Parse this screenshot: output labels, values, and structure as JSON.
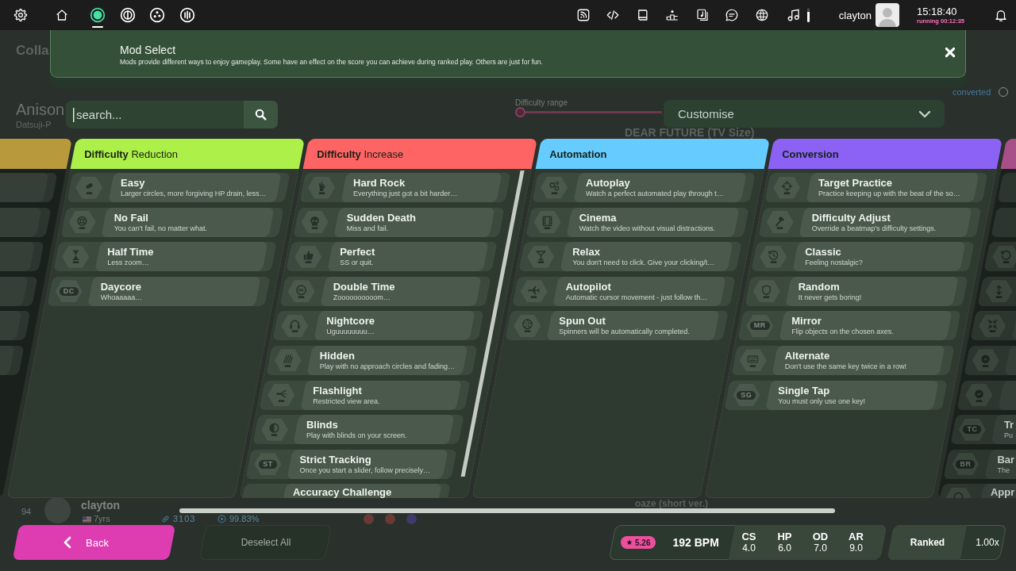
{
  "toolbar": {
    "modes": [
      {
        "selected": true
      },
      {
        "selected": false
      },
      {
        "selected": false
      },
      {
        "selected": false
      }
    ],
    "volume": {
      "level": 0.7
    },
    "username": "clayton",
    "clock": {
      "time": "15:18:40",
      "runtime": "running 00:12:35"
    }
  },
  "header": {
    "title": "Mod Select",
    "description": "Mods provide different ways to enjoy gameplay. Some have an effect on the score you can achieve during ranked play. Others are just for fun."
  },
  "search": {
    "placeholder": "search..."
  },
  "preset_dropdown": {
    "value": "Customise"
  },
  "columns": [
    {
      "color": "#b89a3c",
      "dimmed": true,
      "mods": [
        {
          "selected": false
        },
        {
          "selected": false
        },
        {
          "selected": false
        },
        {
          "selected": false
        },
        {
          "selected": false
        },
        {
          "selected": false
        }
      ]
    },
    {
      "title": "Difficulty Reduction",
      "color": "#aef04a",
      "dimmed": false,
      "mods": [
        {
          "title": "Easy",
          "description": "Larger circles, more forgiving HP drain, less…",
          "selected": false
        },
        {
          "title": "No Fail",
          "description": "You can't fail, no matter what.",
          "selected": false
        },
        {
          "title": "Half Time",
          "description": "Less zoom…",
          "selected": false
        },
        {
          "acronym": "DC",
          "title": "Daycore",
          "description": "Whoaaaaa…",
          "selected": false
        }
      ]
    },
    {
      "title": "Difficulty Increase",
      "color": "#fe6464",
      "dimmed": false,
      "mods": [
        {
          "title": "Hard Rock",
          "description": "Everything just got a bit harder…",
          "selected": false
        },
        {
          "title": "Sudden Death",
          "description": "Miss and fail.",
          "selected": false
        },
        {
          "title": "Perfect",
          "description": "SS or quit.",
          "selected": false
        },
        {
          "title": "Double Time",
          "description": "Zoooooooooom…",
          "selected": false
        },
        {
          "title": "Nightcore",
          "description": "Uguuuuuuuu…",
          "selected": false
        },
        {
          "title": "Hidden",
          "description": "Play with no approach circles and fading…",
          "selected": false
        },
        {
          "title": "Flashlight",
          "description": "Restricted view area.",
          "selected": false
        },
        {
          "title": "Blinds",
          "description": "Play with blinds on your screen.",
          "selected": false
        },
        {
          "acronym": "ST",
          "title": "Strict Tracking",
          "description": "Once you start a slider, follow precisely…",
          "selected": false
        },
        {
          "title": "Accuracy Challenge",
          "selected": false
        }
      ]
    },
    {
      "title": "Automation",
      "color": "#66ccff",
      "dimmed": false,
      "mods": [
        {
          "title": "Autoplay",
          "description": "Watch a perfect automated play through t…",
          "selected": false
        },
        {
          "title": "Cinema",
          "description": "Watch the video without visual distractions.",
          "selected": false
        },
        {
          "title": "Relax",
          "description": "You don't need to click. Give your clicking/t…",
          "selected": false
        },
        {
          "title": "Autopilot",
          "description": "Automatic cursor movement - just follow th…",
          "selected": false
        },
        {
          "title": "Spun Out",
          "description": "Spinners will be automatically completed.",
          "selected": false
        }
      ]
    },
    {
      "title": "Conversion",
      "color": "#8c62f5",
      "dimmed": false,
      "mods": [
        {
          "title": "Target Practice",
          "description": "Practice keeping up with the beat of the so…",
          "selected": false
        },
        {
          "title": "Difficulty Adjust",
          "description": "Override a beatmap's difficulty settings.",
          "selected": false
        },
        {
          "title": "Classic",
          "description": "Feeling nostalgic?",
          "selected": false
        },
        {
          "title": "Random",
          "description": "It never gets boring!",
          "selected": false
        },
        {
          "acronym": "MR",
          "title": "Mirror",
          "description": "Flip objects on the chosen axes.",
          "selected": false
        },
        {
          "title": "Alternate",
          "description": "Don't use the same key twice in a row!",
          "selected": false
        },
        {
          "acronym": "SG",
          "title": "Single Tap",
          "description": "You must only use one key!",
          "selected": false
        }
      ]
    },
    {
      "color": "#a84f8a",
      "dimmed": true,
      "mods": [
        {
          "selected": false
        },
        {
          "selected": false
        },
        {
          "selected": false
        },
        {
          "selected": false
        },
        {
          "selected": false
        },
        {
          "selected": false
        },
        {
          "selected": false
        },
        {
          "acronym": "TC",
          "title": "Tr",
          "description": "Pu",
          "selected": false
        },
        {
          "acronym": "BR",
          "title": "Bar",
          "description": "The",
          "selected": false
        },
        {
          "title": "Appr",
          "selected": false
        }
      ]
    }
  ],
  "footer": {
    "back_label": "Back",
    "deselect_all": {
      "label": "Deselect All",
      "disabled": true
    },
    "beatmap_info": {
      "star_rating": "5.26",
      "bpm": "192 BPM",
      "stats": [
        {
          "label": "CS",
          "value": "4.0"
        },
        {
          "label": "HP",
          "value": "6.0"
        },
        {
          "label": "OD",
          "value": "7.0"
        },
        {
          "label": "AR",
          "value": "9.0"
        }
      ]
    },
    "ranked": "Ranked",
    "multiplier": "1.00x"
  },
  "song_select_behind": {
    "filter_label": "Colla",
    "beatmap": {
      "title": "Anison",
      "artist": "Datsuji-P"
    },
    "difficulty_range": {
      "label": "Difficulty range"
    },
    "show_converted": {
      "label": "converted",
      "checked": false
    },
    "carousel_titles": [
      "DEAR FUTURE (TV Size)",
      "oaze (short ver.)"
    ],
    "top_score": {
      "rank": "94",
      "username": "clayton",
      "age": "7yrs",
      "score": "3103",
      "accuracy": "99.83%"
    }
  }
}
